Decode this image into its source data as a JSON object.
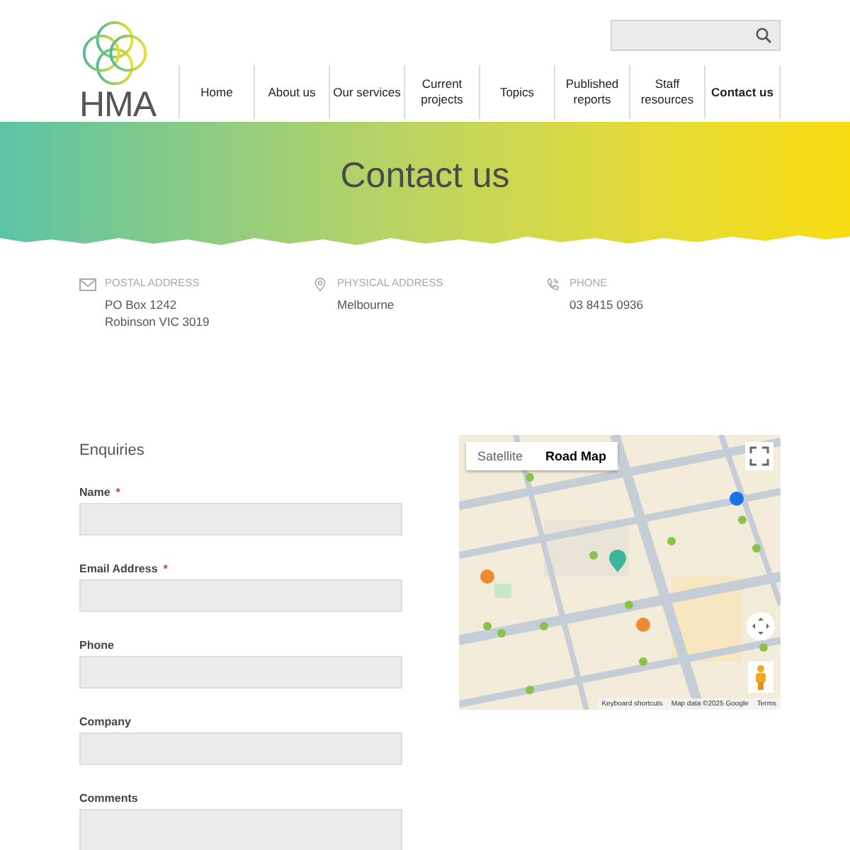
{
  "logo": {
    "text": "HMA"
  },
  "nav": [
    {
      "label": "Home",
      "selected": false
    },
    {
      "label": "About us",
      "selected": false
    },
    {
      "label": "Our services",
      "selected": false
    },
    {
      "label": "Current projects",
      "selected": false
    },
    {
      "label": "Topics",
      "selected": false
    },
    {
      "label": "Published reports",
      "selected": false
    },
    {
      "label": "Staff resources",
      "selected": false
    },
    {
      "label": "Contact us",
      "selected": true
    }
  ],
  "banner": {
    "title": "Contact us"
  },
  "contacts": [
    {
      "kind": "mail",
      "label": "POSTAL ADDRESS",
      "lines": [
        "PO Box 1242",
        "Robinson VIC 3019"
      ]
    },
    {
      "kind": "pin",
      "label": "PHYSICAL ADDRESS",
      "lines": [
        "Melbourne"
      ]
    },
    {
      "kind": "phone",
      "label": "PHONE",
      "lines": [
        "03 8415 0936"
      ]
    }
  ],
  "form": {
    "title": "Enquiries",
    "fields": [
      {
        "kind": "input",
        "label": "Name",
        "required_mark": "*"
      },
      {
        "kind": "input",
        "label": "Email Address",
        "required_mark": "*"
      },
      {
        "kind": "input",
        "label": "Phone"
      },
      {
        "kind": "input",
        "label": "Company"
      },
      {
        "kind": "textarea",
        "label": "Comments"
      }
    ]
  },
  "map": {
    "map_types": [
      {
        "label": "Satellite",
        "selected": false
      },
      {
        "label": "Road Map",
        "selected": true
      }
    ],
    "attribution": [
      "Keyboard shortcuts",
      "Map data ©2025 Google",
      "Terms"
    ]
  }
}
